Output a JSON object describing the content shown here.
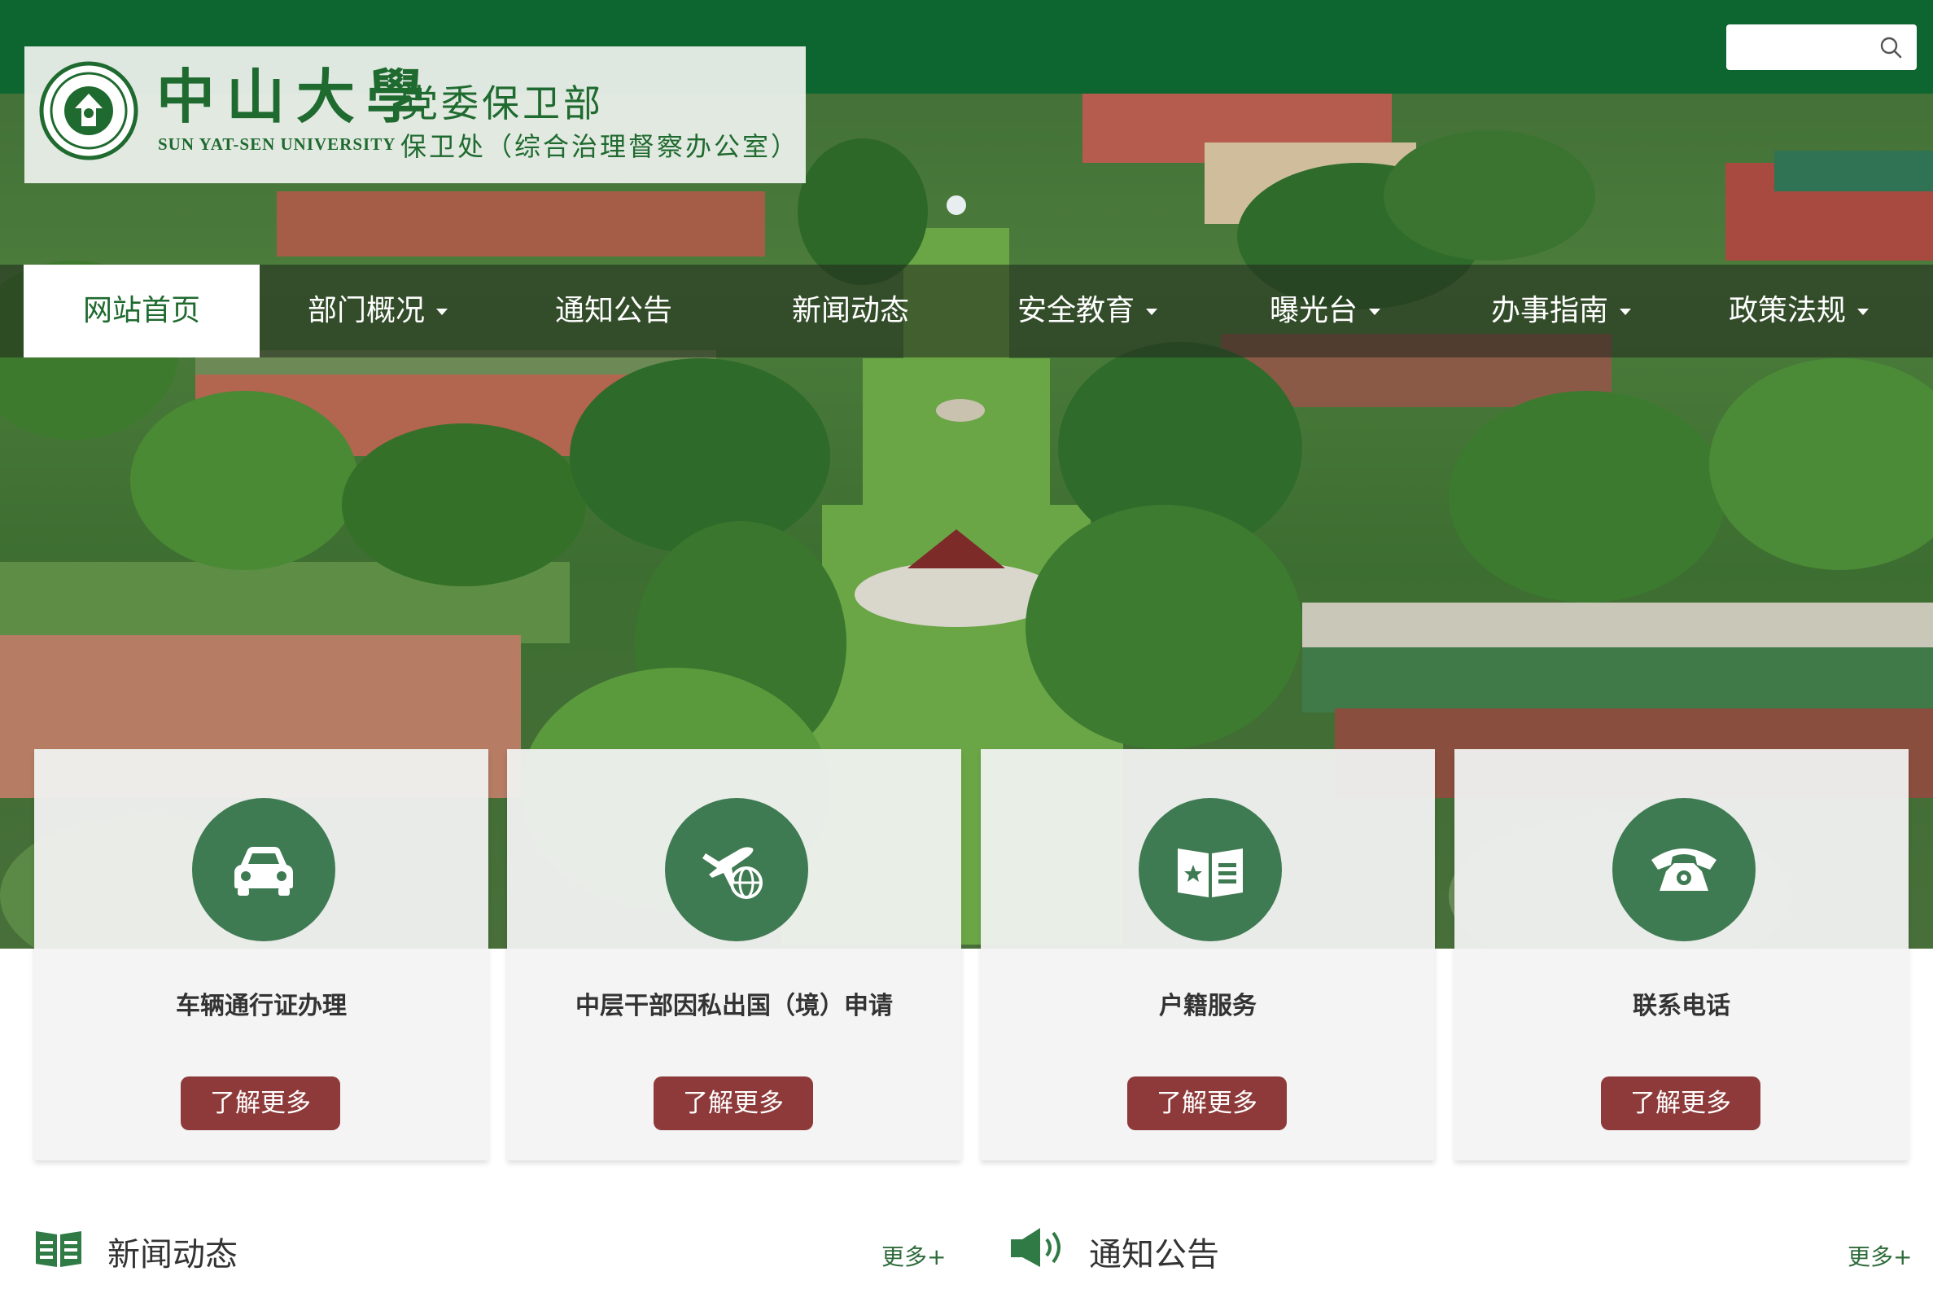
{
  "site": {
    "logo_university_cn": "中山大學",
    "logo_university_en": "SUN YAT-SEN UNIVERSITY",
    "logo_department": "党委保卫部",
    "logo_office": "保卫处（综合治理督察办公室）",
    "seal_icon": "university-seal-icon",
    "brand_color": "#0d6530"
  },
  "search": {
    "placeholder": "",
    "icon": "search-icon"
  },
  "nav": {
    "items": [
      {
        "label": "网站首页",
        "active": true,
        "dropdown": false
      },
      {
        "label": "部门概况",
        "active": false,
        "dropdown": true
      },
      {
        "label": "通知公告",
        "active": false,
        "dropdown": false
      },
      {
        "label": "新闻动态",
        "active": false,
        "dropdown": false
      },
      {
        "label": "安全教育",
        "active": false,
        "dropdown": true
      },
      {
        "label": "曝光台",
        "active": false,
        "dropdown": true
      },
      {
        "label": "办事指南",
        "active": false,
        "dropdown": true
      },
      {
        "label": "政策法规",
        "active": false,
        "dropdown": true
      }
    ]
  },
  "services": {
    "cards": [
      {
        "title": "车辆通行证办理",
        "button": "了解更多",
        "icon": "car-icon"
      },
      {
        "title": "中层干部因私出国（境）申请",
        "button": "了解更多",
        "icon": "plane-globe-icon"
      },
      {
        "title": "户籍服务",
        "button": "了解更多",
        "icon": "id-book-icon"
      },
      {
        "title": "联系电话",
        "button": "了解更多",
        "icon": "telephone-icon"
      }
    ],
    "icon_circle_color": "#3e7a52",
    "button_color": "#8e3a3a"
  },
  "sections": {
    "news": {
      "title": "新闻动态",
      "more": "更多+",
      "icon": "news-book-icon"
    },
    "notices": {
      "title": "通知公告",
      "more": "更多+",
      "icon": "speaker-icon"
    }
  }
}
